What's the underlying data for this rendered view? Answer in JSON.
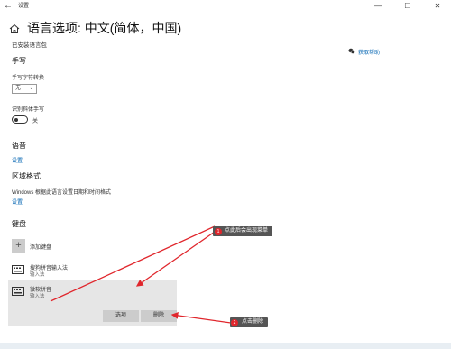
{
  "window": {
    "title": "设置",
    "minimize": "—",
    "maximize": "☐",
    "close": "✕",
    "back": "←"
  },
  "page": {
    "title": "语言选项: 中文(简体，中国)",
    "installed_text": "已安装语言包"
  },
  "help": {
    "label": "获取帮助"
  },
  "handwriting": {
    "heading": "手写",
    "font_label": "手写字符转换",
    "font_value": "无",
    "recognize_label": "识别斜体手写",
    "toggle_state": "关"
  },
  "voice": {
    "heading": "语音",
    "link": "设置"
  },
  "region": {
    "heading": "区域格式",
    "description": "Windows 根据此语言设置日期和时间格式",
    "link": "设置"
  },
  "keyboards": {
    "heading": "键盘",
    "add_label": "添加键盘",
    "items": [
      {
        "name": "搜狗拼音输入法",
        "type": "输入法"
      },
      {
        "name": "微软拼音",
        "type": "输入法"
      }
    ],
    "options_button": "选项",
    "delete_button": "删除"
  },
  "annotations": [
    {
      "number": "1",
      "text": "点此后会出现菜单"
    },
    {
      "number": "2",
      "text": "点击删除"
    }
  ],
  "colors": {
    "accent_link": "#0063b1",
    "annotation_red": "#e0262c",
    "callout_bg": "#555555"
  }
}
